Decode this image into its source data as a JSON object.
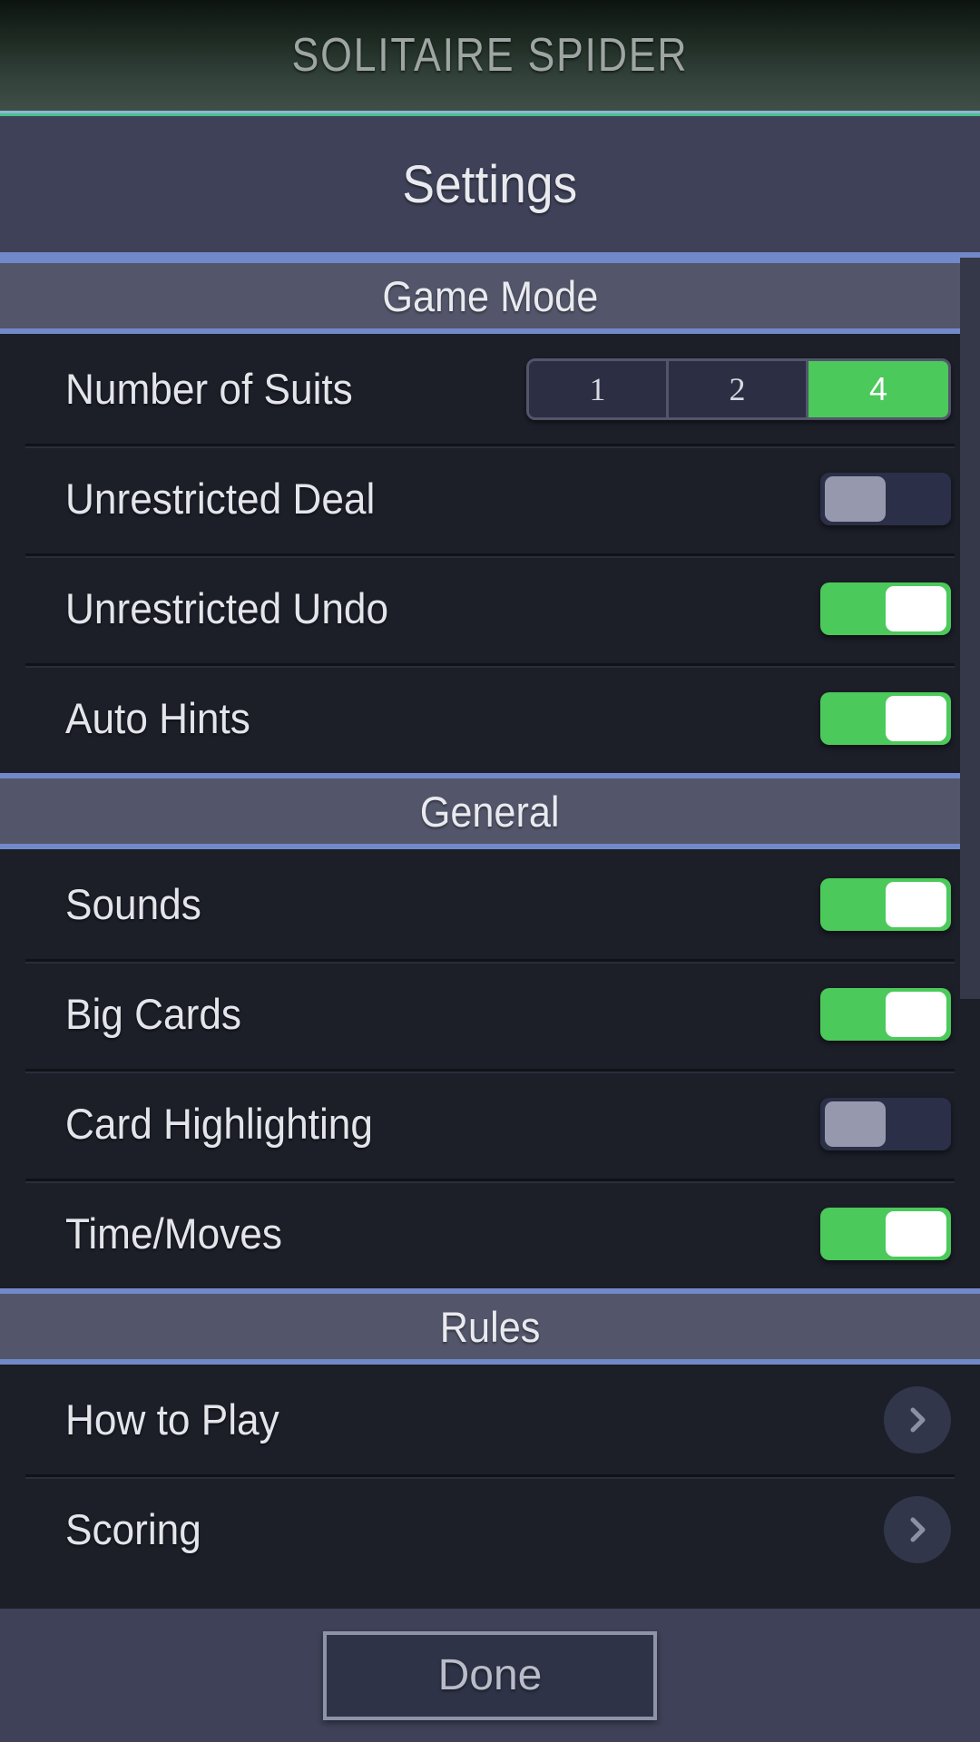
{
  "app": {
    "game_title": "SOLITAIRE SPIDER",
    "screen_title": "Settings"
  },
  "colors": {
    "accent_green": "#4BC95A",
    "rule_blue": "#7189c9",
    "rule_teal": "#49c08f",
    "section_header_bg": "#53566a",
    "row_bg": "#1c1e28",
    "bar_bg": "#3e4157",
    "toggle_off_track": "#2b3048",
    "toggle_off_knob": "#9699ad"
  },
  "sections": [
    {
      "header": "Game Mode",
      "rows": [
        {
          "label": "Number of Suits",
          "control": "segmented",
          "options": [
            "1",
            "2",
            "4"
          ],
          "selected": "4"
        },
        {
          "label": "Unrestricted Deal",
          "control": "toggle",
          "value": "off"
        },
        {
          "label": "Unrestricted Undo",
          "control": "toggle",
          "value": "on"
        },
        {
          "label": "Auto Hints",
          "control": "toggle",
          "value": "on"
        }
      ]
    },
    {
      "header": "General",
      "rows": [
        {
          "label": "Sounds",
          "control": "toggle",
          "value": "on"
        },
        {
          "label": "Big Cards",
          "control": "toggle",
          "value": "on"
        },
        {
          "label": "Card Highlighting",
          "control": "toggle",
          "value": "off"
        },
        {
          "label": "Time/Moves",
          "control": "toggle",
          "value": "on"
        }
      ]
    },
    {
      "header": "Rules",
      "rows": [
        {
          "label": "How to Play",
          "control": "chevron"
        },
        {
          "label": "Scoring",
          "control": "chevron"
        }
      ]
    }
  ],
  "scrollbar": {
    "thumb_top": 0,
    "thumb_height": 817
  },
  "footer": {
    "done_label": "Done"
  }
}
